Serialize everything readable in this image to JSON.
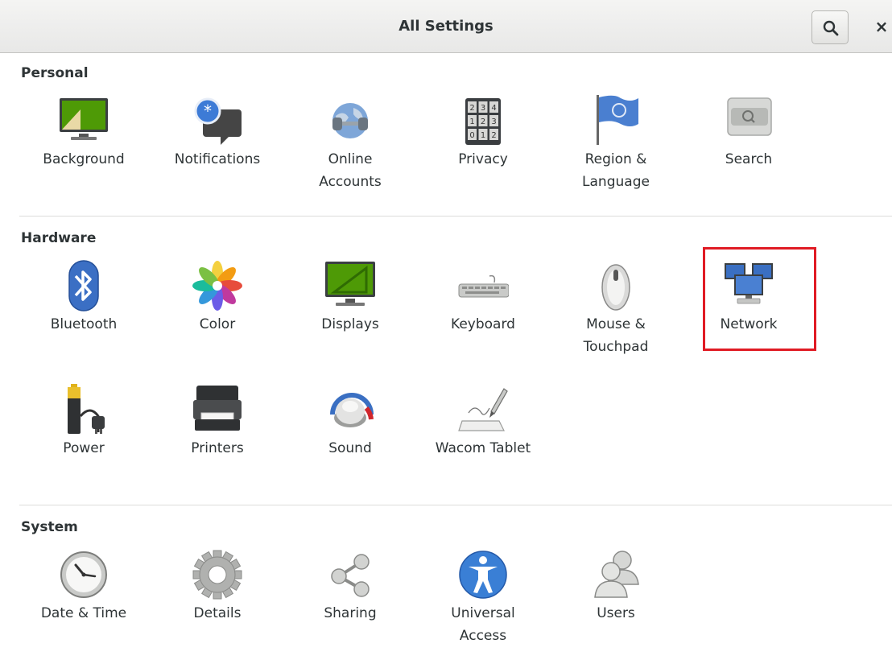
{
  "window": {
    "title": "All Settings",
    "search_icon": "search-icon",
    "close_label": "×"
  },
  "sections": {
    "personal": {
      "title": "Personal",
      "items": [
        {
          "label": "Background",
          "icon": "background-icon"
        },
        {
          "label": "Notifications",
          "icon": "notifications-icon"
        },
        {
          "label": "Online\nAccounts",
          "icon": "online-accounts-icon"
        },
        {
          "label": "Privacy",
          "icon": "privacy-icon"
        },
        {
          "label": "Region &\nLanguage",
          "icon": "region-language-icon"
        },
        {
          "label": "Search",
          "icon": "search-panel-icon"
        }
      ]
    },
    "hardware": {
      "title": "Hardware",
      "items": [
        {
          "label": "Bluetooth",
          "icon": "bluetooth-icon"
        },
        {
          "label": "Color",
          "icon": "color-icon"
        },
        {
          "label": "Displays",
          "icon": "displays-icon"
        },
        {
          "label": "Keyboard",
          "icon": "keyboard-icon"
        },
        {
          "label": "Mouse &\nTouchpad",
          "icon": "mouse-icon"
        },
        {
          "label": "Network",
          "icon": "network-icon"
        },
        {
          "label": "Power",
          "icon": "power-icon"
        },
        {
          "label": "Printers",
          "icon": "printer-icon"
        },
        {
          "label": "Sound",
          "icon": "sound-icon"
        },
        {
          "label": "Wacom Tablet",
          "icon": "wacom-tablet-icon"
        }
      ]
    },
    "system": {
      "title": "System",
      "items": [
        {
          "label": "Date & Time",
          "icon": "clock-icon"
        },
        {
          "label": "Details",
          "icon": "gear-icon"
        },
        {
          "label": "Sharing",
          "icon": "share-icon"
        },
        {
          "label": "Universal\nAccess",
          "icon": "accessibility-icon"
        },
        {
          "label": "Users",
          "icon": "users-icon"
        }
      ]
    }
  },
  "colors": {
    "highlight": "#e01b24",
    "bluetooth": "#3b6fc4",
    "accessibility": "#3a7fd5"
  }
}
